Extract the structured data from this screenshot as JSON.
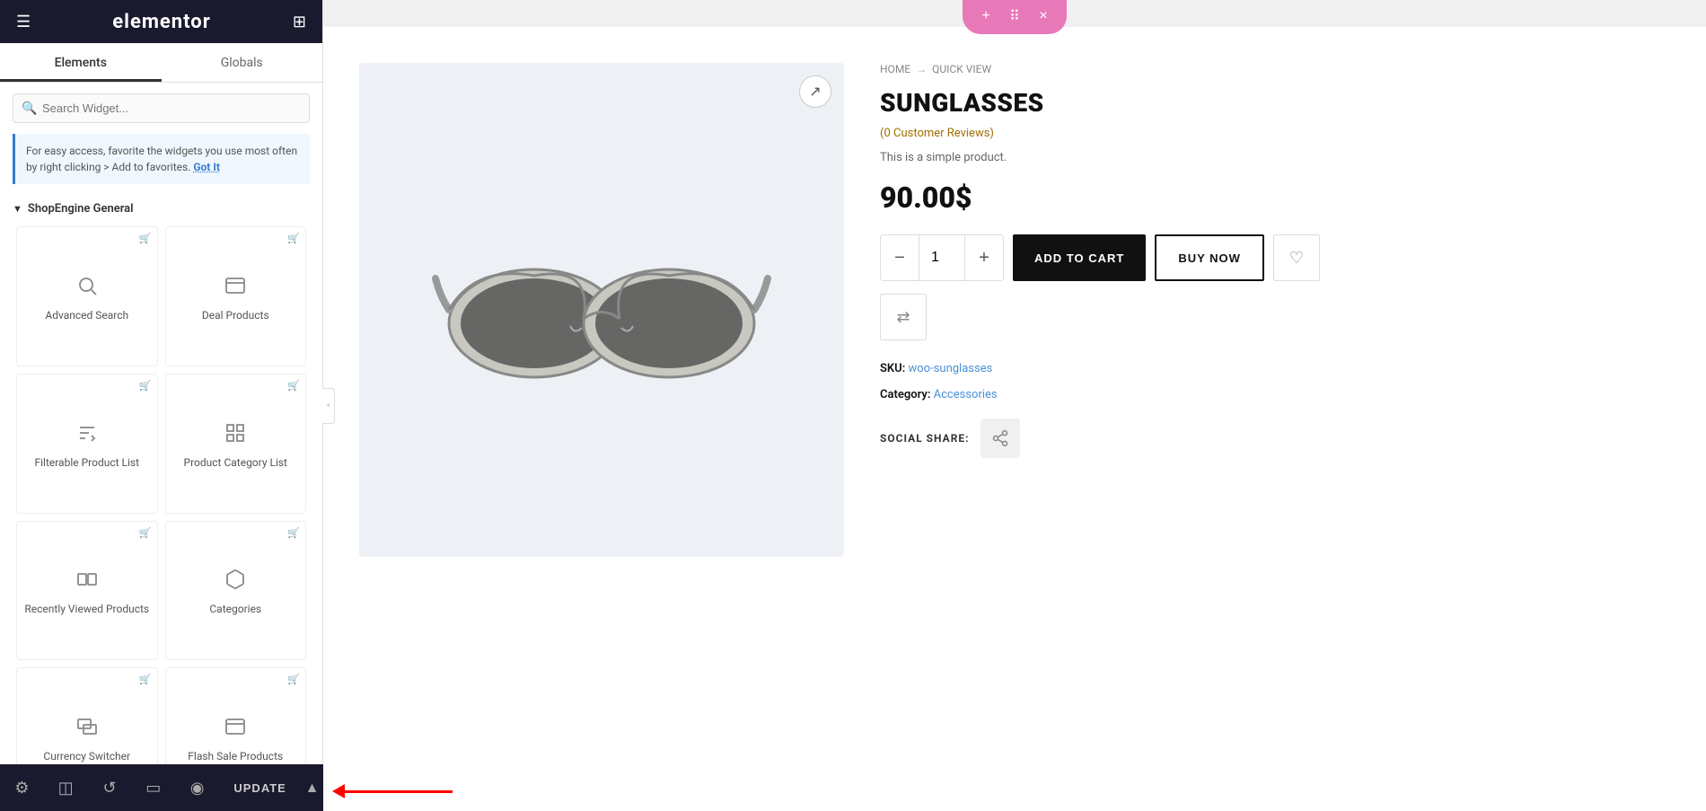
{
  "sidebar": {
    "title": "elementor",
    "tabs": [
      {
        "label": "Elements",
        "active": true
      },
      {
        "label": "Globals",
        "active": false
      }
    ],
    "search_placeholder": "Search Widget...",
    "info_text": "For easy access, favorite the widgets you use most often by right clicking > Add to favorites.",
    "info_got_it": "Got It",
    "section_title": "ShopEngine General",
    "widgets": [
      {
        "label": "Advanced Search",
        "icon": "search"
      },
      {
        "label": "Deal Products",
        "icon": "archive"
      },
      {
        "label": "Filterable Product List",
        "icon": "list-filter"
      },
      {
        "label": "Product Category List",
        "icon": "package"
      },
      {
        "label": "Recently Viewed Products",
        "icon": "box-multiple"
      },
      {
        "label": "Categories",
        "icon": "package-alt"
      },
      {
        "label": "Currency Switcher",
        "icon": "box-photo"
      },
      {
        "label": "Flash Sale Products",
        "icon": "archive-flash"
      }
    ]
  },
  "toolbar": {
    "add_icon": "+",
    "move_icon": "⠿",
    "close_icon": "×"
  },
  "breadcrumb": {
    "home": "HOME",
    "separator": "→",
    "current": "QUICK VIEW"
  },
  "product": {
    "title": "SUNGLASSES",
    "reviews": "(0 Customer Reviews)",
    "description": "This is a simple product.",
    "price": "90.00$",
    "qty": "1",
    "add_to_cart_label": "ADD TO CART",
    "buy_now_label": "BUY NOW",
    "sku_label": "SKU:",
    "sku_value": "woo-sunglasses",
    "category_label": "Category:",
    "category_value": "Accessories",
    "social_share_label": "SOCIAL SHARE:"
  },
  "bottom_bar": {
    "update_label": "UPDATE",
    "icons": [
      "settings",
      "layers",
      "history",
      "responsive",
      "eye"
    ]
  },
  "colors": {
    "sidebar_bg": "#1a1a2e",
    "accent_pink": "#e879b8",
    "add_to_cart_bg": "#111111",
    "buy_now_border": "#111111",
    "info_border": "#3a7bd5",
    "info_bg": "#f0f7ff",
    "review_color": "#a07000"
  }
}
